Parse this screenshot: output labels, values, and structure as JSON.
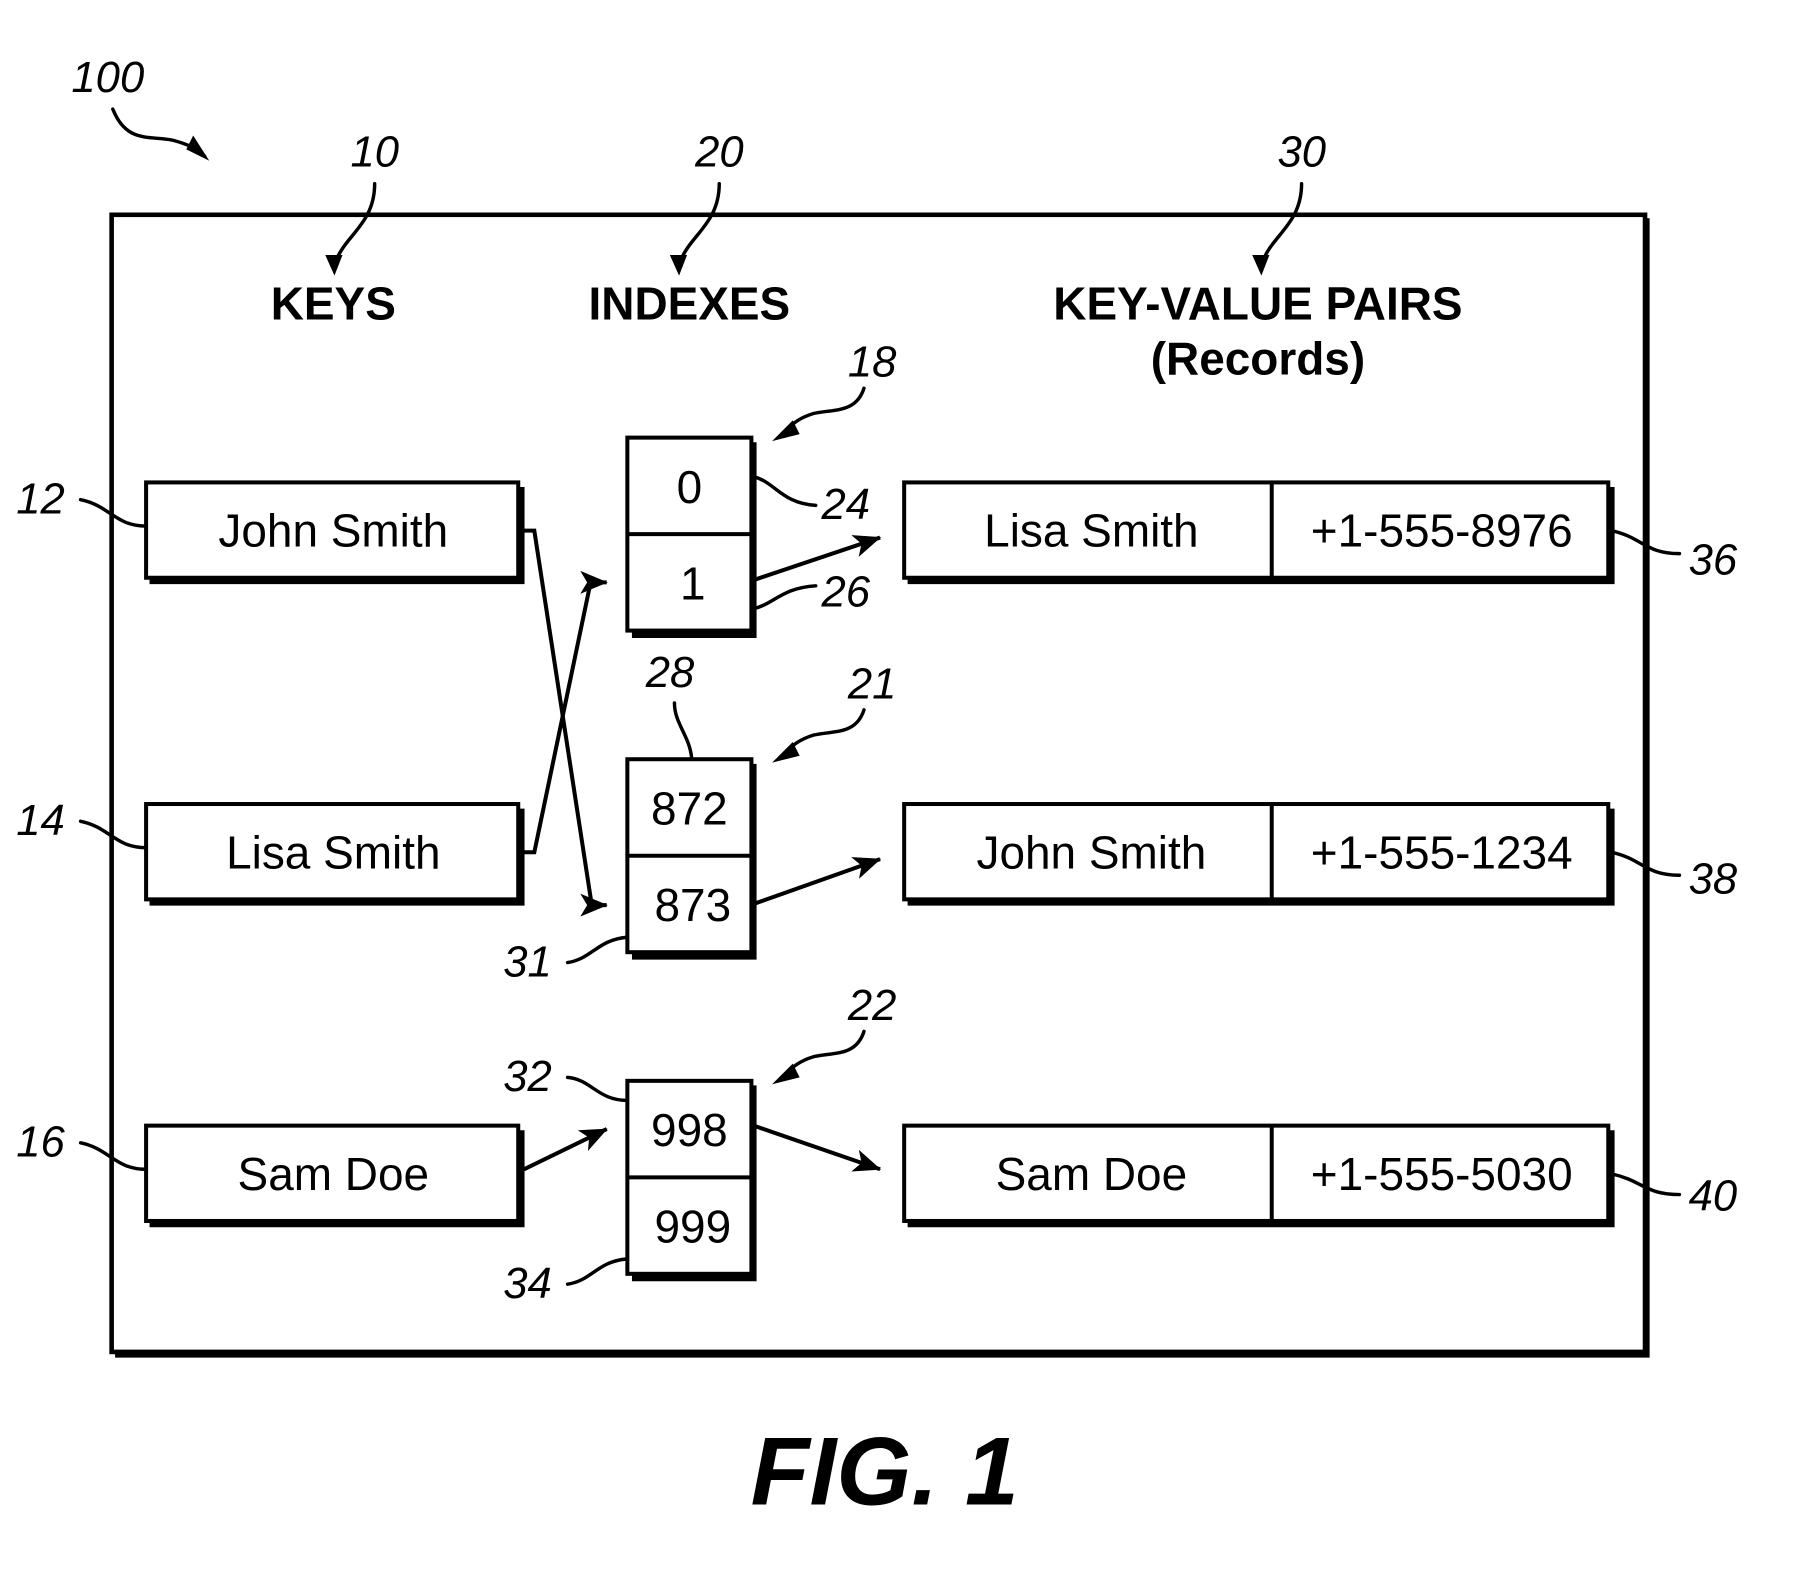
{
  "figure": {
    "caption": "FIG. 1",
    "system_ref": "100"
  },
  "columns": {
    "keys": {
      "heading": "KEYS",
      "ref": "10"
    },
    "indexes": {
      "heading": "INDEXES",
      "ref": "20"
    },
    "records": {
      "heading_line1": "KEY-VALUE PAIRS",
      "heading_line2": "(Records)",
      "ref": "30"
    }
  },
  "keys": [
    {
      "ref": "12",
      "label": "John Smith"
    },
    {
      "ref": "14",
      "label": "Lisa Smith"
    },
    {
      "ref": "16",
      "label": "Sam Doe"
    }
  ],
  "index_groups": [
    {
      "ref": "18",
      "cells": [
        {
          "value": "0",
          "ref": "24"
        },
        {
          "value": "1",
          "ref": "26"
        }
      ]
    },
    {
      "ref": "21",
      "cells": [
        {
          "value": "872",
          "ref": "28"
        },
        {
          "value": "873",
          "ref": "31"
        }
      ]
    },
    {
      "ref": "22",
      "cells": [
        {
          "value": "998",
          "ref": "32"
        },
        {
          "value": "999",
          "ref": "34"
        }
      ]
    }
  ],
  "records": [
    {
      "ref": "36",
      "key": "Lisa Smith",
      "value": "+1-555-8976"
    },
    {
      "ref": "38",
      "key": "John Smith",
      "value": "+1-555-1234"
    },
    {
      "ref": "40",
      "key": "Sam Doe",
      "value": "+1-555-5030"
    }
  ],
  "mappings": [
    {
      "from_key": "John Smith",
      "to_index": "873",
      "to_record": "John Smith"
    },
    {
      "from_key": "Lisa Smith",
      "to_index": "1",
      "to_record": "Lisa Smith"
    },
    {
      "from_key": "Sam Doe",
      "to_index": "998",
      "to_record": "Sam Doe"
    }
  ]
}
